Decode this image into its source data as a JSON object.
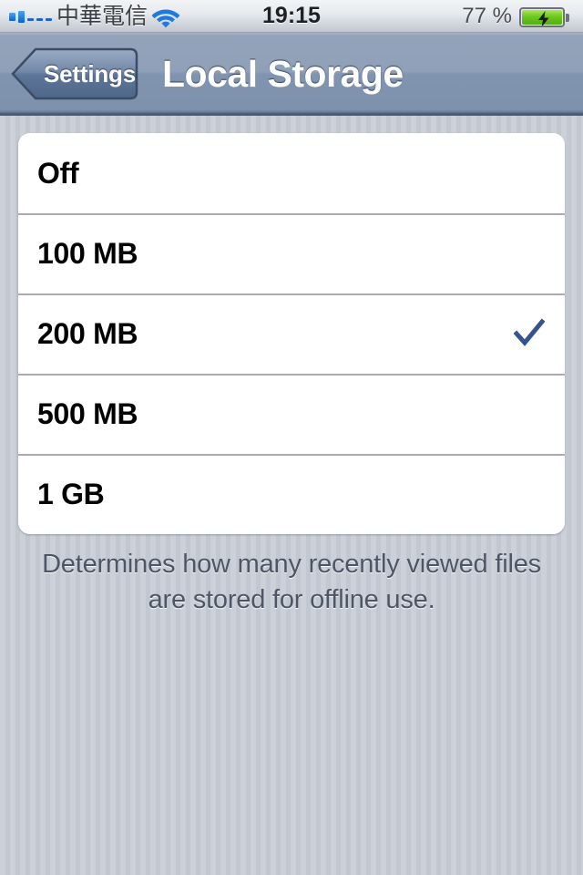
{
  "status_bar": {
    "signal_icon": "signal-bars-icon",
    "signal_bars_filled": 2,
    "signal_bars_empty": 3,
    "carrier": "中華電信",
    "wifi_icon": "wifi-icon",
    "time": "19:15",
    "battery_percent": "77 %",
    "battery_icon": "battery-charging-icon",
    "battery_level": 77,
    "charging": true
  },
  "nav_bar": {
    "back_label": "Settings",
    "back_icon": "chevron-left-icon",
    "title": "Local Storage"
  },
  "options": {
    "selected_value": "200 MB",
    "check_icon": "checkmark-icon",
    "items": [
      {
        "label": "Off",
        "selected": false
      },
      {
        "label": "100 MB",
        "selected": false
      },
      {
        "label": "200 MB",
        "selected": true
      },
      {
        "label": "500 MB",
        "selected": false
      },
      {
        "label": "1 GB",
        "selected": false
      }
    ]
  },
  "footer": {
    "note": "Determines how many recently viewed files are stored for offline use."
  },
  "colors": {
    "nav_bar": "#8094af",
    "background": "#c9ced6",
    "checkmark": "#34548c",
    "footer_text": "#4d5667",
    "cell_background": "#ffffff",
    "separator": "#a9abae",
    "battery_green": "#6ec721",
    "signal_blue": "#1f63c4"
  }
}
